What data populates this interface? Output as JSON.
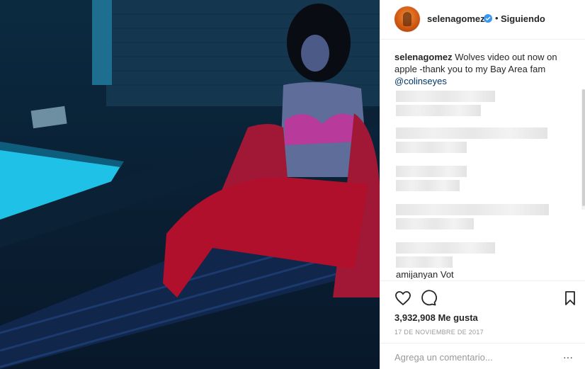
{
  "post": {
    "username": "selenagomez",
    "separator": "•",
    "follow_status": "Siguiendo",
    "caption_user": "selenagomez",
    "caption_text": " Wolves video out now on apple -thank you to my Bay Area fam ",
    "caption_mention": "@colinseyes",
    "partial_comment": "amijanyan Vot",
    "likes": "3,932,908 Me gusta",
    "date": "17 DE NOVIEMBRE DE 2017",
    "comment_placeholder": "Agrega un comentario...",
    "more_glyph": "···"
  },
  "icons": [
    "heart-icon",
    "comment-icon",
    "bookmark-icon",
    "verified-badge-icon",
    "more-options-icon"
  ],
  "colors": {
    "verified": "#3897f0",
    "mention": "#003569",
    "muted": "#999999"
  }
}
